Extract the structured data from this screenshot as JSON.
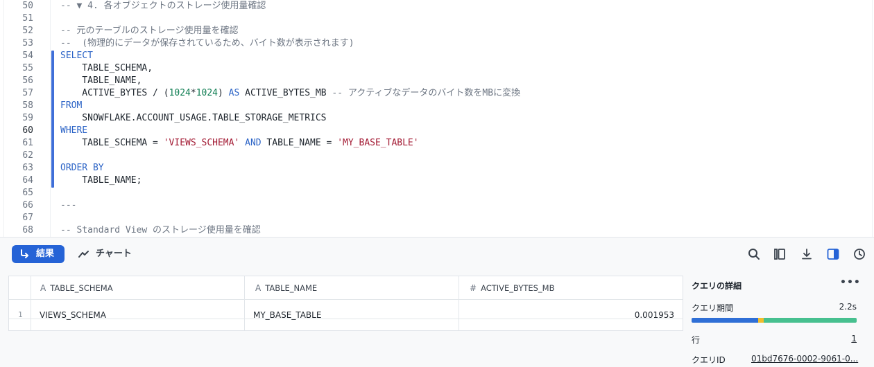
{
  "editor": {
    "lines": [
      {
        "n": "50",
        "tokens": [
          {
            "t": "-- ▼ 4. 各オブジェクトのストレージ使用量確認",
            "c": "cm"
          }
        ]
      },
      {
        "n": "51",
        "tokens": []
      },
      {
        "n": "52",
        "tokens": [
          {
            "t": "-- 元のテーブルのストレージ使用量を確認",
            "c": "cm"
          }
        ]
      },
      {
        "n": "53",
        "tokens": [
          {
            "t": "--  (物理的にデータが保存されているため、バイト数が表示されます)",
            "c": "cm"
          }
        ]
      },
      {
        "n": "54",
        "tokens": [
          {
            "t": "SELECT",
            "c": "kw"
          }
        ]
      },
      {
        "n": "55",
        "tokens": [
          {
            "t": "    TABLE_SCHEMA,",
            "c": "plain"
          }
        ]
      },
      {
        "n": "56",
        "tokens": [
          {
            "t": "    TABLE_NAME,",
            "c": "plain"
          }
        ]
      },
      {
        "n": "57",
        "tokens": [
          {
            "t": "    ACTIVE_BYTES / (",
            "c": "plain"
          },
          {
            "t": "1024",
            "c": "num"
          },
          {
            "t": "*",
            "c": "plain"
          },
          {
            "t": "1024",
            "c": "num"
          },
          {
            "t": ") ",
            "c": "plain"
          },
          {
            "t": "AS",
            "c": "kw"
          },
          {
            "t": " ACTIVE_BYTES_MB ",
            "c": "plain"
          },
          {
            "t": "-- アクティブなデータのバイト数をMBに変換",
            "c": "cm"
          }
        ]
      },
      {
        "n": "58",
        "tokens": [
          {
            "t": "FROM",
            "c": "kw"
          }
        ]
      },
      {
        "n": "59",
        "tokens": [
          {
            "t": "    SNOWFLAKE.ACCOUNT_USAGE.TABLE_STORAGE_METRICS",
            "c": "plain"
          }
        ]
      },
      {
        "n": "60",
        "active": true,
        "tokens": [
          {
            "t": "WHERE",
            "c": "kw"
          }
        ]
      },
      {
        "n": "61",
        "tokens": [
          {
            "t": "    TABLE_SCHEMA = ",
            "c": "plain"
          },
          {
            "t": "'VIEWS_SCHEMA'",
            "c": "str"
          },
          {
            "t": " ",
            "c": "plain"
          },
          {
            "t": "AND",
            "c": "kw"
          },
          {
            "t": " TABLE_NAME = ",
            "c": "plain"
          },
          {
            "t": "'MY_BASE_TABLE'",
            "c": "str"
          }
        ]
      },
      {
        "n": "62",
        "tokens": []
      },
      {
        "n": "63",
        "tokens": [
          {
            "t": "ORDER BY",
            "c": "kw"
          }
        ]
      },
      {
        "n": "64",
        "tokens": [
          {
            "t": "    TABLE_NAME;",
            "c": "plain"
          }
        ]
      },
      {
        "n": "65",
        "tokens": []
      },
      {
        "n": "66",
        "tokens": [
          {
            "t": "---",
            "c": "cm"
          }
        ]
      },
      {
        "n": "67",
        "tokens": []
      },
      {
        "n": "68",
        "tokens": [
          {
            "t": "-- Standard View のストレージ使用量を確認",
            "c": "cm"
          }
        ]
      }
    ]
  },
  "toolbar": {
    "results_tab": "結果",
    "chart_tab": "チャート",
    "icons": [
      "search-icon",
      "columns-icon",
      "download-icon",
      "side-panel-icon",
      "history-icon"
    ]
  },
  "grid": {
    "columns": [
      {
        "type_icon": "A",
        "name": "TABLE_SCHEMA"
      },
      {
        "type_icon": "A",
        "name": "TABLE_NAME"
      },
      {
        "type_icon": "#",
        "name": "ACTIVE_BYTES_MB"
      }
    ],
    "rows": [
      {
        "num": "1",
        "cells": [
          "VIEWS_SCHEMA",
          "MY_BASE_TABLE",
          "0.001953"
        ]
      }
    ]
  },
  "details": {
    "title": "クエリの詳細",
    "more": "•••",
    "duration_label": "クエリ期間",
    "duration_value": "2.2s",
    "duration_breakdown": [
      {
        "fraction": 0.405,
        "color": "#2f6fd6"
      },
      {
        "fraction": 0.03,
        "color": "#f1bd2c"
      },
      {
        "fraction": 0.565,
        "color": "#47c08f"
      }
    ],
    "rows_label": "行",
    "rows_value": "1",
    "query_id_label": "クエリID",
    "query_id_value": "01bd7676-0002-9061-0..."
  },
  "colors": {
    "accent": "#2563d6",
    "selection_bar": "#3f6fd8"
  }
}
